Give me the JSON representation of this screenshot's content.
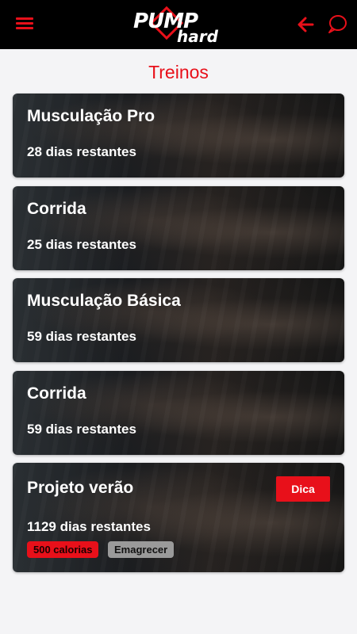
{
  "header": {
    "logo_top": "PUMP",
    "logo_bottom": "hard",
    "icons": {
      "menu": "hamburger-menu-icon",
      "back": "arrow-left-icon",
      "chat": "chat-bubble-icon"
    },
    "accent_color": "#e8101a",
    "background_color": "#000000"
  },
  "page": {
    "title": "Treinos"
  },
  "workouts": [
    {
      "title": "Musculação Pro",
      "days": "28 dias restantes"
    },
    {
      "title": "Corrida",
      "days": "25 dias restantes"
    },
    {
      "title": "Musculação Básica",
      "days": "59 dias restantes"
    },
    {
      "title": "Corrida",
      "days": "59 dias restantes"
    },
    {
      "title": "Projeto verão",
      "days": "1129 dias restantes",
      "tip_label": "Dica",
      "tags": [
        "500 calorias",
        "Emagrecer"
      ]
    }
  ]
}
